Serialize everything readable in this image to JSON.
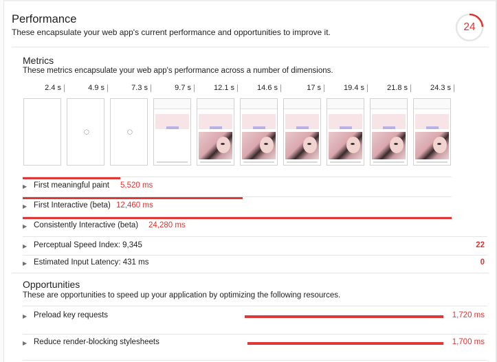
{
  "performance": {
    "title": "Performance",
    "description": "These encapsulate your web app's current performance and opportunities to improve it.",
    "score": "24",
    "score_fraction": 0.24,
    "score_color": "#df332f"
  },
  "metrics": {
    "title": "Metrics",
    "description": "These metrics encapsulate your web app's performance across a number of dimensions.",
    "filmstrip_times": [
      "2.4 s",
      "4.9 s",
      "7.3 s",
      "9.7 s",
      "12.1 s",
      "14.6 s",
      "17 s",
      "19.4 s",
      "21.8 s",
      "24.3 s"
    ],
    "items": [
      {
        "label": "First meaningful paint",
        "value": "5,520 ms",
        "score": ""
      },
      {
        "label": "First Interactive (beta)",
        "value": "12,460 ms",
        "score": ""
      },
      {
        "label": "Consistently Interactive (beta)",
        "value": "24,280 ms",
        "score": ""
      },
      {
        "label": "Perceptual Speed Index: 9,345",
        "value": "",
        "score": "22"
      },
      {
        "label": "Estimated Input Latency: 431 ms",
        "value": "",
        "score": "0"
      }
    ]
  },
  "opportunities": {
    "title": "Opportunities",
    "description": "These are opportunities to speed up your application by optimizing the following resources.",
    "items": [
      {
        "label": "Preload key requests",
        "value": "1,720 ms"
      },
      {
        "label": "Reduce render-blocking stylesheets",
        "value": "1,700 ms"
      }
    ]
  },
  "colors": {
    "accent_red": "#db3a37",
    "text": "#212121"
  }
}
